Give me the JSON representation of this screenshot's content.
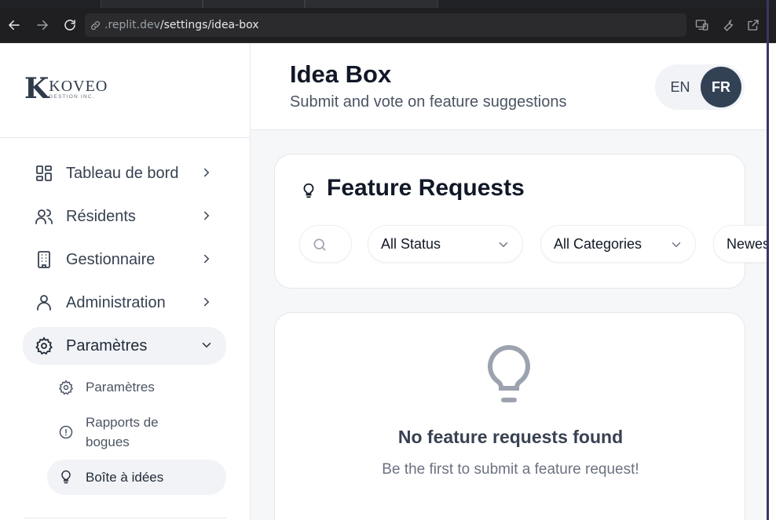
{
  "browser": {
    "url_host": ".replit.dev",
    "url_path": "/settings/idea-box"
  },
  "logo": {
    "mark": "K",
    "title": "KOVEO",
    "subtitle": "GESTION INC."
  },
  "sidebar": {
    "items": [
      {
        "label": "Tableau de bord",
        "icon": "dashboard-icon"
      },
      {
        "label": "Résidents",
        "icon": "users-icon"
      },
      {
        "label": "Gestionnaire",
        "icon": "building-icon"
      },
      {
        "label": "Administration",
        "icon": "user-icon"
      },
      {
        "label": "Paramètres",
        "icon": "gear-icon",
        "expanded": true
      }
    ],
    "sub_items": [
      {
        "label": "Paramètres",
        "icon": "gear-icon"
      },
      {
        "label": "Rapports de bogues",
        "icon": "alert-circle-icon"
      },
      {
        "label": "Boîte à idées",
        "icon": "lightbulb-icon",
        "active": true
      }
    ]
  },
  "header": {
    "title": "Idea Box",
    "subtitle": "Submit and vote on feature suggestions",
    "lang_en": "EN",
    "lang_fr": "FR",
    "active_lang": "FR"
  },
  "requests": {
    "title": "Feature Requests",
    "filters": {
      "status": "All Status",
      "category": "All Categories",
      "sort": "Newest"
    }
  },
  "empty_state": {
    "title": "No feature requests found",
    "subtitle": "Be the first to submit a feature request!"
  },
  "colors": {
    "accent": "#334155",
    "active_bg": "#f1f3f6",
    "content_bg": "#f6f7f9"
  }
}
